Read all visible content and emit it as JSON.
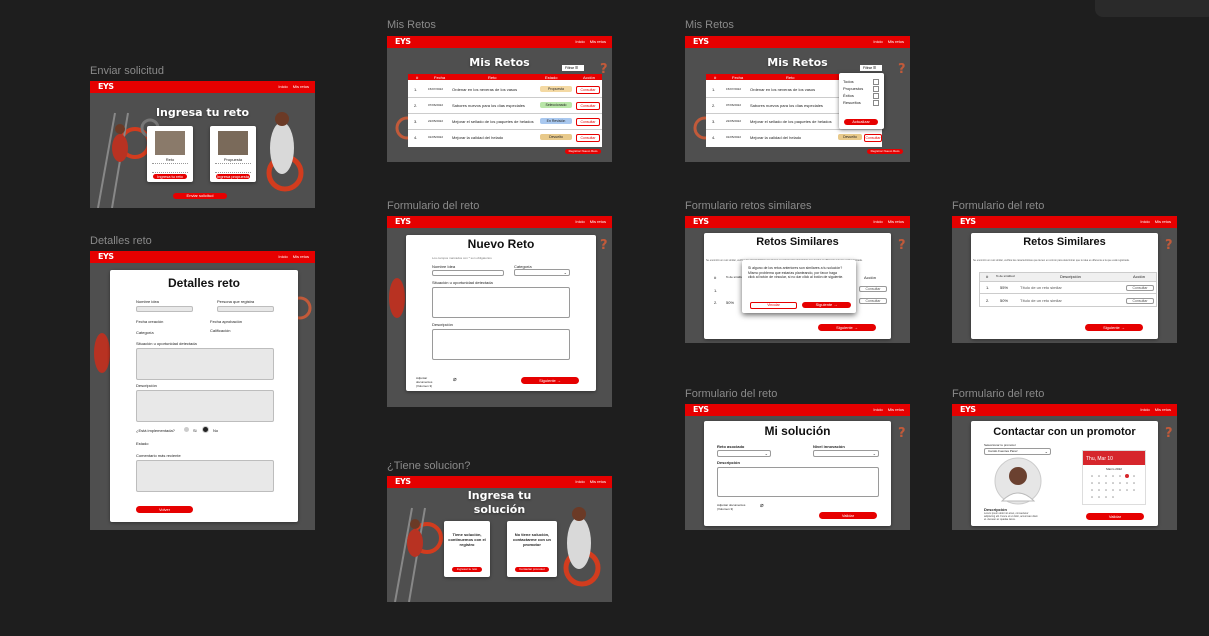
{
  "canvas_labels": {
    "enviar": "Enviar solicitud",
    "detalles": "Detalles reto",
    "mis1": "Mis Retos",
    "mis2": "Mis Retos",
    "form1": "Formulario del reto",
    "similares": "Formulario retos similares",
    "form2": "Formulario del reto",
    "tiene": "¿Tiene solucion?",
    "form3": "Formulario del reto",
    "form4": "Formulario del reto"
  },
  "nav": {
    "logo": "EYS",
    "link1": "Inicio",
    "link2": "Mis retos"
  },
  "enviar": {
    "title": "Ingresa tu reto",
    "card1_name": "Reto",
    "card2_name": "Propuesta",
    "card1_btn": "Ingresa tu reto",
    "card2_btn": "Ingresa propuesta",
    "bottom_btn": "Enviar solicitud"
  },
  "detalles": {
    "title": "Detalles reto",
    "nombre": "Nombre idea",
    "persona": "Persona que registra",
    "fecha_creacion": "Fecha creación",
    "fecha_aprob": "Fecha aprobación",
    "categoria": "Categoría",
    "calificacion": "Calificación",
    "situacion": "Situación u oportunidad detectada",
    "descripcion": "Descripción",
    "implementada": "¿Está implementada?",
    "si": "Si",
    "no": "No",
    "estado": "Estado",
    "comentario": "Comentario más reciente",
    "volver": "Volver"
  },
  "mis_retos": {
    "title": "Mis Retos",
    "filter": "Filtrar",
    "headers": [
      "#",
      "Fecha",
      "Reto",
      "Estado",
      "Acción"
    ],
    "rows": [
      {
        "n": "1.",
        "fecha": "15/07/2022",
        "reto": "Ordenar en los neveras de los vasos",
        "estado": "Propuesta",
        "accion": "Consultar"
      },
      {
        "n": "2.",
        "fecha": "07/06/2022",
        "reto": "Sabores nuevos para los días especiales",
        "estado": "Seleccionado",
        "accion": "Consultar"
      },
      {
        "n": "3.",
        "fecha": "22/05/2022",
        "reto": "Mejorar el sellado de los paquetes de helados",
        "estado": "En Revisión",
        "accion": "Consultar"
      },
      {
        "n": "4.",
        "fecha": "01/05/2022",
        "reto": "Mejorar la calidad del helado",
        "estado": "Devuelto",
        "accion": "Consultar"
      }
    ],
    "register_btn": "Registrar Nuevo Reto",
    "filter_options": [
      "Todos",
      "Propuestos",
      "Éxitos",
      "Resueltos"
    ],
    "apply_btn": "Actualizar"
  },
  "nuevo_reto": {
    "title": "Nuevo Reto",
    "subtitle": "Los campos marcados con * son obligatorios",
    "nombre": "Nombre Idea",
    "categoria": "Categoría",
    "situacion": "Situación u oportunidad detectada",
    "descripcion": "Descripción",
    "adjuntar": "Adjuntar documentos (Volumen 3)",
    "siguiente": "Siguiente →"
  },
  "similares": {
    "title": "Retos Similares",
    "intro": "Se encontró un reto similar, verifica las características que tienen en común para determinar que tu idea es diferente a la que está registrada.",
    "headers": [
      "#",
      "% de similitud",
      "Descripción",
      "Acción"
    ],
    "rows": [
      {
        "n": "1.",
        "pct": "55%",
        "desc": "Título de un reto similar",
        "accion": "Consultar"
      },
      {
        "n": "2.",
        "pct": "50%",
        "desc": "Título de un reto similar",
        "accion": "Consultar"
      }
    ],
    "modal_text": "Si alguno de los retos anteriores son similares a tu solución? Mismo problema que estarías planteando, por favor haga click al botón de vincular, si no dar click al botón de siguiente.",
    "modal_vincular": "Vincular",
    "modal_siguiente": "Siguiente →",
    "siguiente": "Siguiente →"
  },
  "tiene": {
    "title": "Ingresa tu solución",
    "card1": "Tiene solución, continuemos con el registro",
    "card2": "No tiene solución, contactarme con un promotor",
    "card1_btn": "Ingresar tu reto",
    "card2_btn": "Contactar promotor"
  },
  "mi_solucion": {
    "title": "Mi solución",
    "reto": "Reto asociado",
    "nivel": "Nivel innovación",
    "descripcion": "Descripción",
    "adjuntar": "Adjuntar documentos (Volumen 3)",
    "validar": "Validar"
  },
  "contactar": {
    "title": "Contactar con un promotor",
    "select_label": "Seleccionar tu promotor",
    "select_value": "Camilo Fuentes Pérez",
    "calendar_date": "Thu, Mar 10",
    "calendar_month": "Marzo 2022",
    "descripcion": "Descripción",
    "desc_text": "Lorem ipsum dolor sit amet, consectetur adipiscing elit. Fusce ut ut dolor, accumsan diam et. Aenean ac quadae lacus.",
    "validar": "Validar"
  },
  "colors": {
    "accent": "#e60000",
    "bg": "#1e1e1e"
  }
}
